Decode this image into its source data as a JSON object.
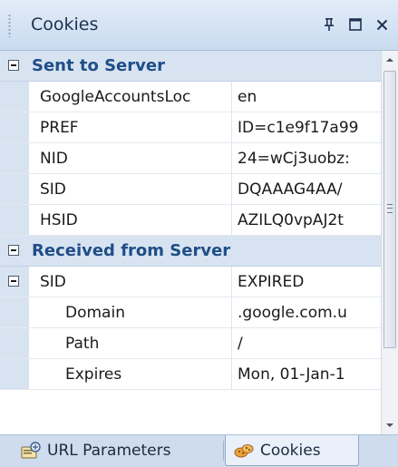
{
  "window": {
    "title": "Cookies",
    "buttons": {
      "pin": "ᵖ",
      "maximize": "□",
      "close": "×"
    }
  },
  "grid": {
    "categories": [
      {
        "label": "Sent to Server",
        "rows": [
          {
            "name": "GoogleAccountsLoc",
            "value": "en"
          },
          {
            "name": "PREF",
            "value": "ID=c1e9f17a9­9"
          },
          {
            "name": "NID",
            "value": "24=wCj3uobz:"
          },
          {
            "name": "SID",
            "value": "DQAAAG4AA/"
          },
          {
            "name": "HSID",
            "value": "AZILQ0vpAJ2t"
          }
        ]
      },
      {
        "label": "Received from Server",
        "rows": [
          {
            "name": "SID",
            "value": "EXPIRED",
            "expanded": true
          },
          {
            "name": "Domain",
            "value": ".google.com.u",
            "sub": true
          },
          {
            "name": "Path",
            "value": "/",
            "sub": true
          },
          {
            "name": "Expires",
            "value": "Mon, 01-Jan-1",
            "sub": true
          }
        ]
      }
    ]
  },
  "tabs": [
    {
      "label": "URL Parameters",
      "icon": "url-parameters-icon",
      "active": false
    },
    {
      "label": "Cookies",
      "icon": "cookies-icon",
      "active": true
    }
  ],
  "colors": {
    "category_text": "#1f4e87",
    "panel_bg": "#d6e3f3",
    "category_bg": "#d8e3f1"
  }
}
